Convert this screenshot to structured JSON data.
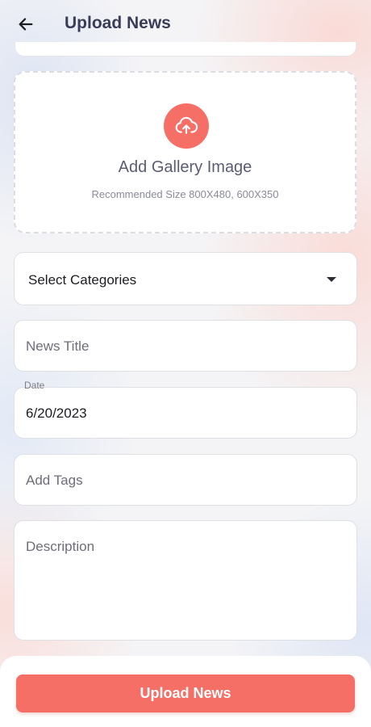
{
  "header": {
    "title": "Upload News",
    "back_icon": "arrow-left-icon"
  },
  "gallery": {
    "icon": "cloud-upload-icon",
    "label": "Add Gallery Image",
    "hint": "Recommended Size 800X480, 600X350"
  },
  "form": {
    "category": {
      "selected": "Select Categories",
      "icon": "caret-down-icon"
    },
    "news_title": {
      "placeholder": "News Title",
      "value": ""
    },
    "date": {
      "label": "Date",
      "value": "6/20/2023"
    },
    "tags": {
      "placeholder": "Add Tags",
      "value": ""
    },
    "description": {
      "placeholder": "Description",
      "value": ""
    }
  },
  "submit": {
    "label": "Upload News"
  },
  "colors": {
    "accent": "#f56f67",
    "title_text": "#3a3d57",
    "background": "#f4f4f6"
  }
}
